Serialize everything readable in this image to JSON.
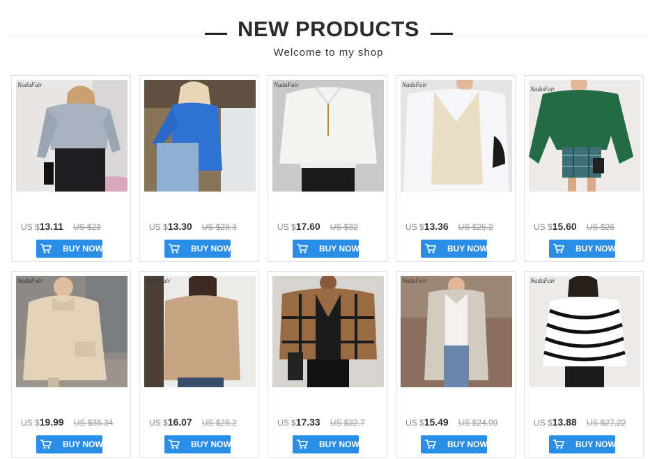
{
  "header": {
    "title": "NEW PRODUCTS",
    "subtitle": "Welcome to my shop"
  },
  "colors": {
    "accent": "#2a8ee6",
    "title": "#2b2b2b",
    "price": "#333333",
    "old_price": "#999999"
  },
  "buy_label": "BUY NOW",
  "products": [
    {
      "currency": "US $",
      "price": "13.11",
      "old_price": "US $23",
      "brand": "NadaFair",
      "item": "grey cable-knit cropped sweater"
    },
    {
      "currency": "US $",
      "price": "13.30",
      "old_price": "US $28.3",
      "brand": "",
      "item": "blue ribbed turtleneck crop"
    },
    {
      "currency": "US $",
      "price": "17.60",
      "old_price": "US $32",
      "brand": "NadaFair",
      "item": "white fleece half-zip crop"
    },
    {
      "currency": "US $",
      "price": "13.36",
      "old_price": "US $25.2",
      "brand": "NadaFair",
      "item": "cream cable-knit sweater vest"
    },
    {
      "currency": "US $",
      "price": "15.60",
      "old_price": "US $26",
      "brand": "NadaFair",
      "item": "green lantern-sleeve sweater"
    },
    {
      "currency": "US $",
      "price": "19.99",
      "old_price": "US $36.34",
      "brand": "NadaFair",
      "item": "beige teddy fleece coat"
    },
    {
      "currency": "US $",
      "price": "16.07",
      "old_price": "US $28.2",
      "brand": "NadaFair",
      "item": "camel turtleneck sweater"
    },
    {
      "currency": "US $",
      "price": "17.33",
      "old_price": "US $32.7",
      "brand": "",
      "item": "brown plaid cardigan"
    },
    {
      "currency": "US $",
      "price": "15.49",
      "old_price": "US $24.99",
      "brand": "NadaFair",
      "item": "grey long cardigan"
    },
    {
      "currency": "US $",
      "price": "13.88",
      "old_price": "US $27.22",
      "brand": "NadaFair",
      "item": "black white striped v-neck sweater"
    }
  ]
}
